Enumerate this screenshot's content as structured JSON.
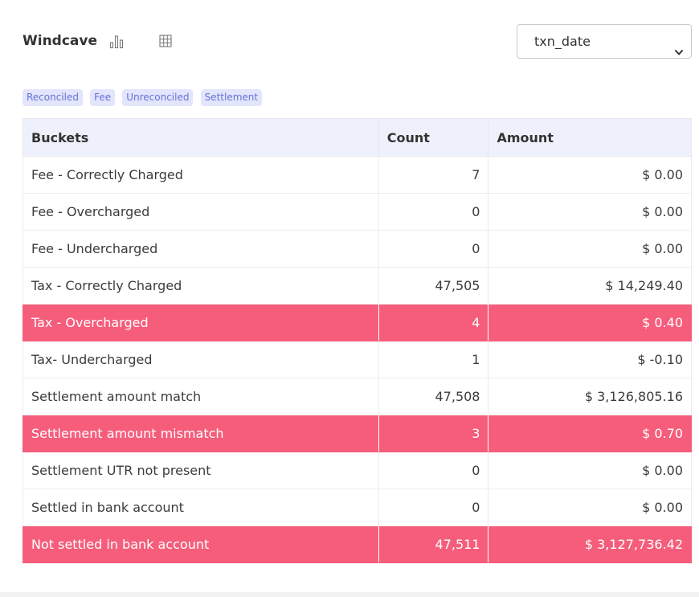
{
  "header": {
    "title": "Windcave",
    "select_value": "txn_date"
  },
  "icons": {
    "chart": "bar-chart-icon",
    "table": "table-grid-icon",
    "dropdown": "chevron-down-icon"
  },
  "tags": [
    "Reconciled",
    "Fee",
    "Unreconciled",
    "Settlement"
  ],
  "table": {
    "headers": [
      "Buckets",
      "Count",
      "Amount"
    ],
    "rows": [
      {
        "bucket": "Fee - Correctly Charged",
        "count": "7",
        "amount": "$ 0.00",
        "highlight": false
      },
      {
        "bucket": "Fee - Overcharged",
        "count": "0",
        "amount": "$ 0.00",
        "highlight": false
      },
      {
        "bucket": "Fee - Undercharged",
        "count": "0",
        "amount": "$ 0.00",
        "highlight": false
      },
      {
        "bucket": "Tax - Correctly Charged",
        "count": "47,505",
        "amount": "$ 14,249.40",
        "highlight": false
      },
      {
        "bucket": "Tax - Overcharged",
        "count": "4",
        "amount": "$ 0.40",
        "highlight": true
      },
      {
        "bucket": "Tax- Undercharged",
        "count": "1",
        "amount": "$ -0.10",
        "highlight": false
      },
      {
        "bucket": "Settlement amount match",
        "count": "47,508",
        "amount": "$ 3,126,805.16",
        "highlight": false
      },
      {
        "bucket": "Settlement amount mismatch",
        "count": "3",
        "amount": "$ 0.70",
        "highlight": true
      },
      {
        "bucket": "Settlement UTR not present",
        "count": "0",
        "amount": "$ 0.00",
        "highlight": false
      },
      {
        "bucket": "Settled in bank account",
        "count": "0",
        "amount": "$ 0.00",
        "highlight": false
      },
      {
        "bucket": "Not settled in bank account",
        "count": "47,511",
        "amount": "$ 3,127,736.42",
        "highlight": true
      }
    ]
  },
  "colors": {
    "alert_row": "#f55d7b",
    "header_bg": "#eef1fb",
    "tag_bg": "#e2e5fb",
    "tag_text": "#6573d6"
  }
}
